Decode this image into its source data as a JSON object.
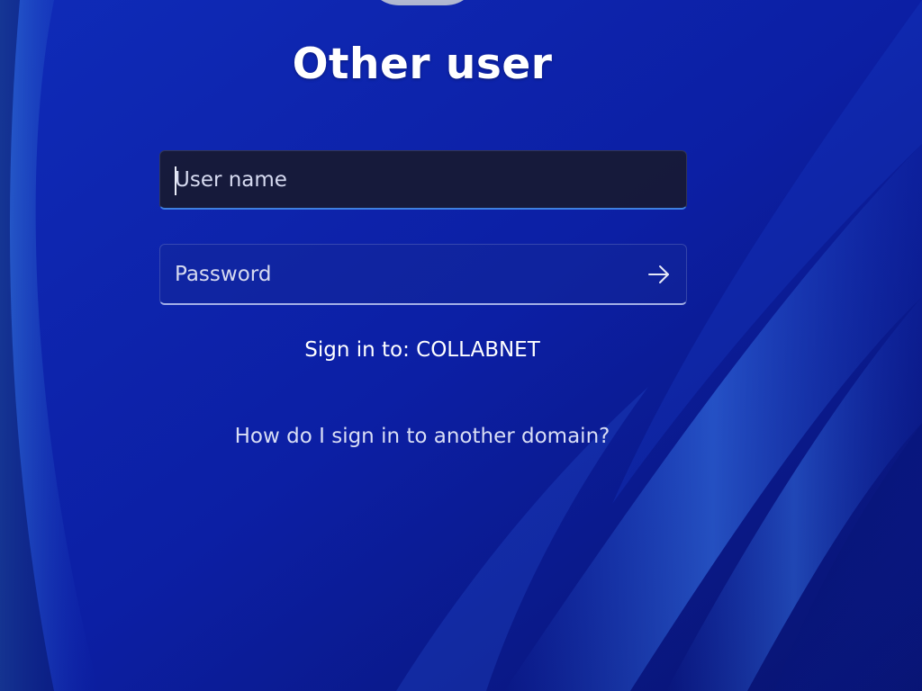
{
  "login": {
    "title": "Other user",
    "username_placeholder": "User name",
    "password_placeholder": "Password",
    "sign_in_label": "Sign in to: COLLABNET",
    "help_link": "How do I sign in to another domain?"
  },
  "icons": {
    "submit": "arrow-right-icon",
    "avatar": "user-avatar"
  },
  "colors": {
    "background": "#0b1fa8",
    "accent": "#3e7fe0",
    "text": "#ffffff"
  }
}
